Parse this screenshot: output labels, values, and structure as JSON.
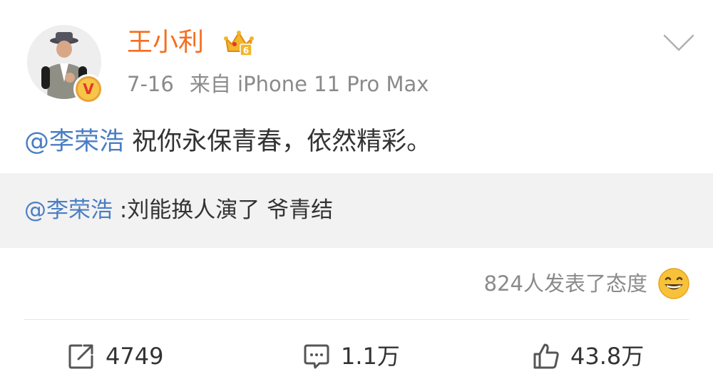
{
  "post": {
    "username": "王小利",
    "timestamp": "7-16",
    "source": "来自 iPhone 11 Pro Max",
    "content": {
      "mention": "@李荣浩",
      "text": " 祝你永保青春，依然精彩。"
    },
    "repost": {
      "mention": "@李荣浩",
      "text": " :刘能换人演了 爷青结"
    },
    "reactions_text": "824人发表了态度",
    "actions": {
      "share_count": "4749",
      "comment_count": "1.1万",
      "like_count": "43.8万"
    }
  },
  "icons": {
    "verified": "v-badge-icon",
    "vip": "crown-icon",
    "more": "chevron-down-icon",
    "reaction": "grinning-emoji-icon",
    "share": "share-icon",
    "comment": "comment-icon",
    "like": "thumbs-up-icon"
  },
  "colors": {
    "username": "#f56e1e",
    "mention": "#4a7ec4",
    "meta": "#8a8a8a",
    "repost_bg": "#f2f2f2"
  }
}
